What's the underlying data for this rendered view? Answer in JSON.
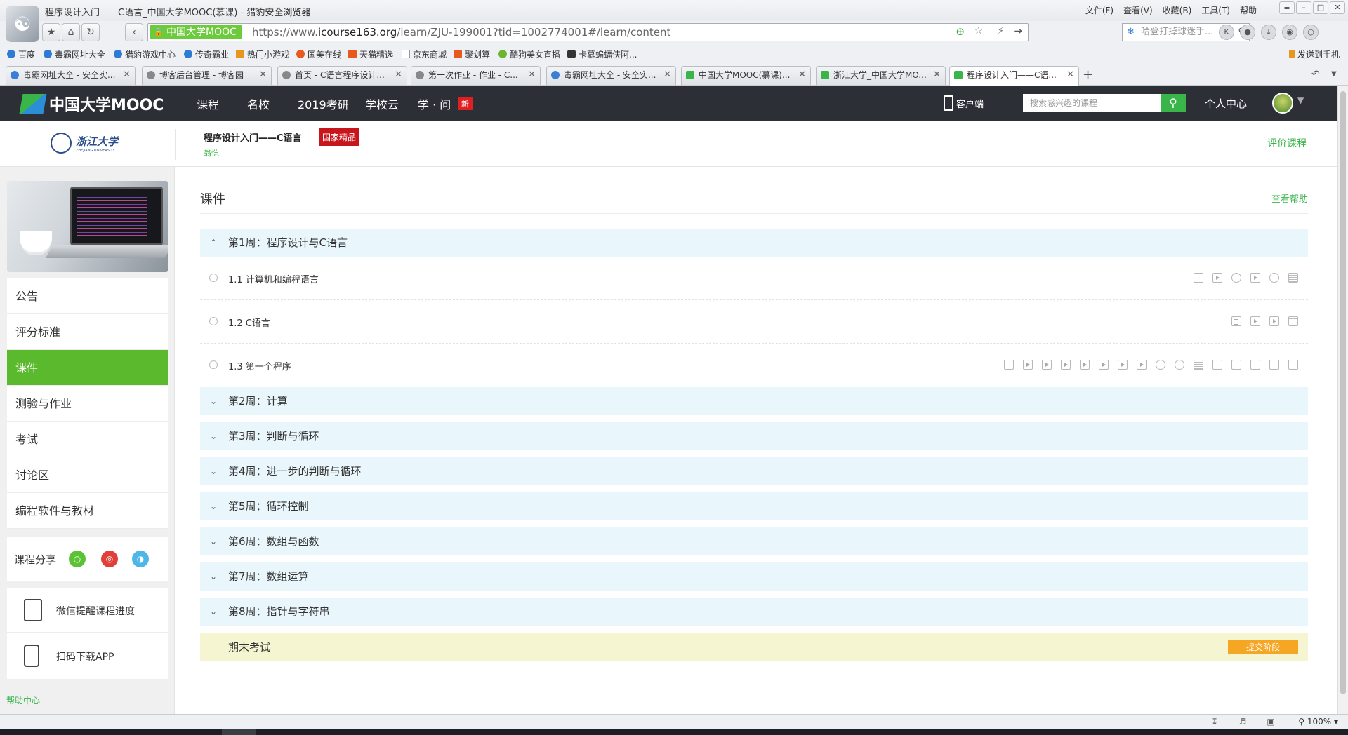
{
  "window": {
    "title": "程序设计入门——C语言_中国大学MOOC(慕课) - 猎豹安全浏览器",
    "menu": [
      "文件(F)",
      "查看(V)",
      "收藏(B)",
      "工具(T)",
      "帮助"
    ],
    "controls": [
      "≡",
      "–",
      "□",
      "✕"
    ]
  },
  "navbar": {
    "badge": "中国大学MOOC",
    "url_prefix": "https://www.",
    "url_domain": "icourse163.org",
    "url_rest": "/learn/ZJU-199001?tid=1002774001#/learn/content",
    "search_placeholder": "哈登打掉球迷手..."
  },
  "bookmarks": [
    {
      "label": "百度",
      "color": "#2e7bd6"
    },
    {
      "label": "毒霸网址大全",
      "color": "#2e7bd6"
    },
    {
      "label": "猎豹游戏中心",
      "color": "#2e7bd6"
    },
    {
      "label": "传奇霸业",
      "color": "#2e7bd6"
    },
    {
      "label": "热门小游戏",
      "color": "#e8961e"
    },
    {
      "label": "国美在线",
      "color": "#e8591e"
    },
    {
      "label": "天猫精选",
      "color": "#e8591e"
    },
    {
      "label": "京东商城",
      "color": "#999999"
    },
    {
      "label": "聚划算",
      "color": "#e8591e"
    },
    {
      "label": "酷狗美女直播",
      "color": "#6cb52e"
    },
    {
      "label": "卡慕蝙蝠侠阿...",
      "color": "#333333"
    }
  ],
  "bookmark_right": "发送到手机",
  "tabs": [
    {
      "label": "毒霸网址大全 - 安全实...",
      "icon_color": "#2e7bd6"
    },
    {
      "label": "博客后台管理 - 博客园",
      "icon_color": "#666666"
    },
    {
      "label": "首页 - C语言程序设计...",
      "icon_color": "#666666"
    },
    {
      "label": "第一次作业 - 作业 - C...",
      "icon_color": "#666666"
    },
    {
      "label": "毒霸网址大全 - 安全实...",
      "icon_color": "#2e7bd6"
    },
    {
      "label": "中国大学MOOC(慕课)...",
      "icon_color": "#39b54a"
    },
    {
      "label": "浙江大学_中国大学MO...",
      "icon_color": "#39b54a"
    },
    {
      "label": "程序设计入门——C语...",
      "icon_color": "#39b54a"
    }
  ],
  "site": {
    "logo": "中国大学MOOC",
    "nav": [
      "课程",
      "名校",
      "2019考研",
      "学校云",
      "学 · 问"
    ],
    "new_badge": "新",
    "client": "客户端",
    "search_placeholder": "搜索感兴趣的课程",
    "search_icon": "search-icon",
    "personal": "个人中心"
  },
  "course": {
    "university": "浙江大学",
    "university_en": "ZHEJIANG UNIVERSITY",
    "title": "程序设计入门——C语言",
    "badge": "国家精品",
    "teacher": "翁恺",
    "rate": "评价课程"
  },
  "sidebar": {
    "items": [
      {
        "label": "公告",
        "active": false
      },
      {
        "label": "评分标准",
        "active": false
      },
      {
        "label": "课件",
        "active": true
      },
      {
        "label": "测验与作业",
        "active": false
      },
      {
        "label": "考试",
        "active": false
      },
      {
        "label": "讨论区",
        "active": false
      },
      {
        "label": "编程软件与教材",
        "active": false
      }
    ],
    "share_label": "课程分享",
    "share_icons": [
      "wechat-icon",
      "weibo-icon",
      "qq-icon"
    ],
    "wechat_remind": "微信提醒课程进度",
    "download_app": "扫码下载APP",
    "help_center": "帮助中心"
  },
  "content": {
    "title": "课件",
    "help": "查看帮助",
    "week1": "第1周：程序设计与C语言",
    "lessons": [
      {
        "title": "1.1 计算机和编程语言",
        "icons": [
          "doc",
          "video",
          "chat",
          "video",
          "chat",
          "test"
        ]
      },
      {
        "title": "1.2 C语言",
        "icons": [
          "doc",
          "video",
          "video",
          "test"
        ]
      },
      {
        "title": "1.3 第一个程序",
        "icons": [
          "doc",
          "video",
          "video",
          "video",
          "video",
          "video",
          "video",
          "video",
          "chat",
          "chat",
          "test",
          "doc",
          "doc",
          "doc",
          "doc",
          "doc"
        ]
      }
    ],
    "weeks": [
      "第2周：计算",
      "第3周：判断与循环",
      "第4周：进一步的判断与循环",
      "第5周：循环控制",
      "第6周：数组与函数",
      "第7周：数组运算",
      "第8周：指针与字符串"
    ],
    "final_exam": "期末考试",
    "submit_stage": "提交阶段"
  },
  "status": {
    "zoom": "100%"
  }
}
